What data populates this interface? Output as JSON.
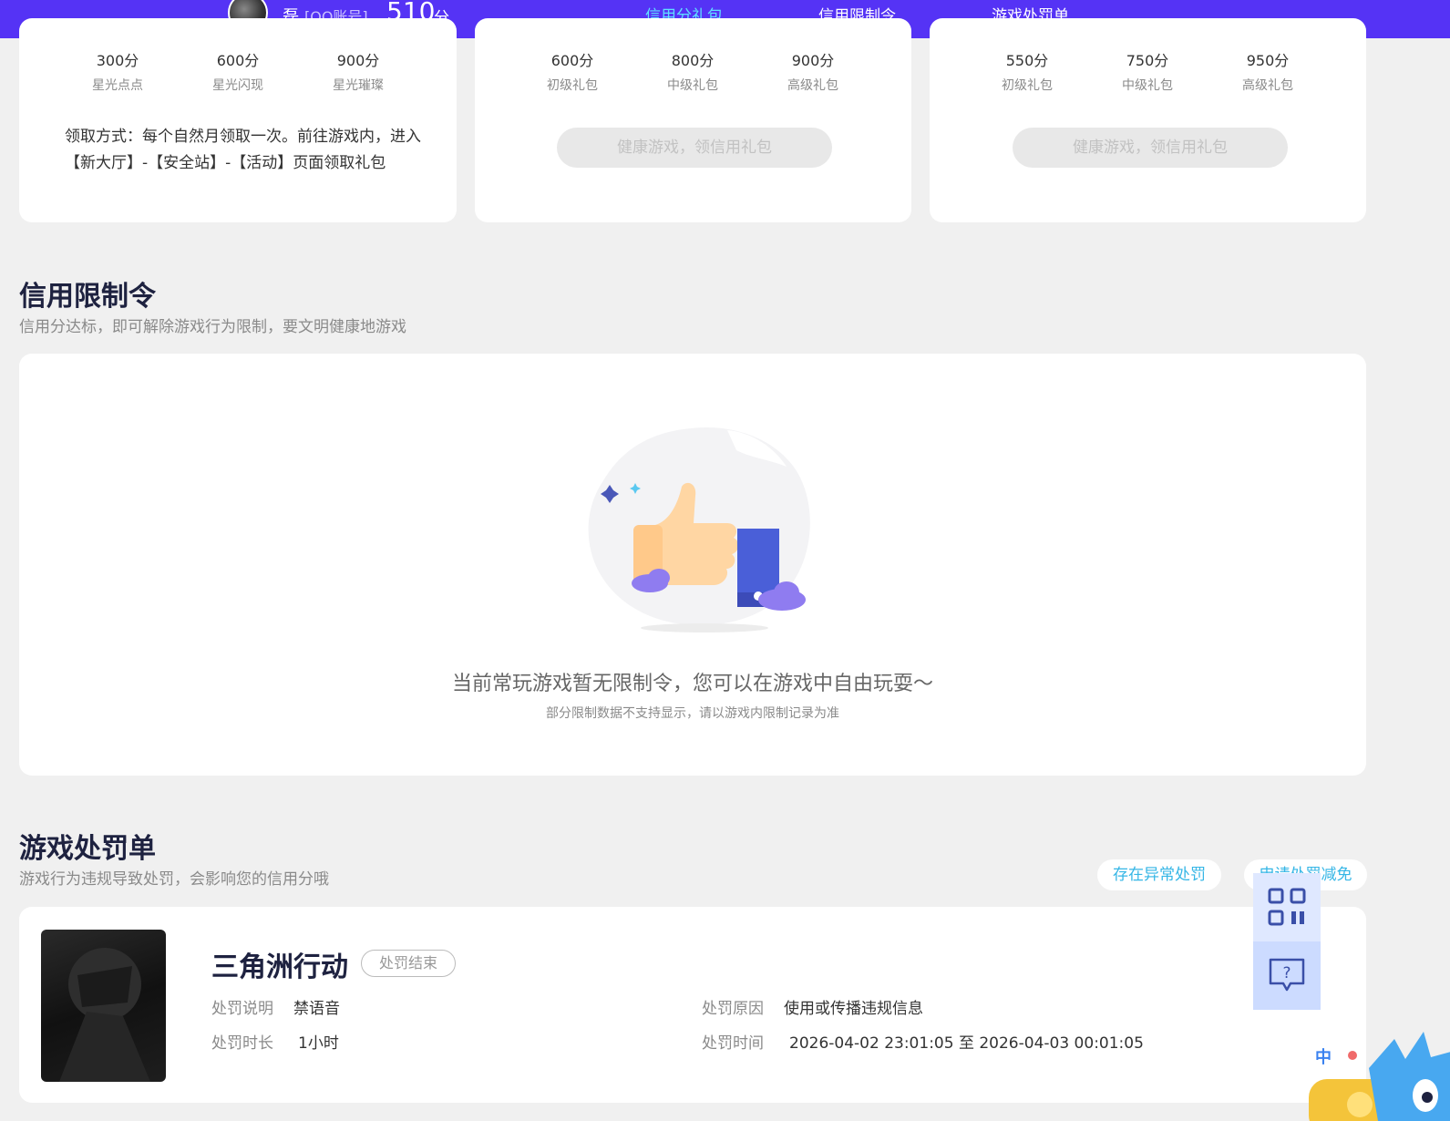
{
  "header": {
    "user_name": "磊",
    "account_type": "[QQ账号]",
    "score": "510",
    "score_unit": "分",
    "tabs": [
      {
        "label": "信用分礼包",
        "active": true
      },
      {
        "label": "信用限制令",
        "active": false
      },
      {
        "label": "游戏处罚单",
        "active": false
      }
    ]
  },
  "gift_cards": [
    {
      "tiers": [
        {
          "points": "300分",
          "name": "星光点点"
        },
        {
          "points": "600分",
          "name": "星光闪现"
        },
        {
          "points": "900分",
          "name": "星光璀璨"
        }
      ],
      "claim_note": "领取方式：每个自然月领取一次。前往游戏内，进入【新大厅】-【安全站】-【活动】页面领取礼包"
    },
    {
      "tiers": [
        {
          "points": "600分",
          "name": "初级礼包"
        },
        {
          "points": "800分",
          "name": "中级礼包"
        },
        {
          "points": "900分",
          "name": "高级礼包"
        }
      ],
      "button_label": "健康游戏，领信用礼包"
    },
    {
      "tiers": [
        {
          "points": "550分",
          "name": "初级礼包"
        },
        {
          "points": "750分",
          "name": "中级礼包"
        },
        {
          "points": "950分",
          "name": "高级礼包"
        }
      ],
      "button_label": "健康游戏，领信用礼包"
    }
  ],
  "restriction": {
    "title": "信用限制令",
    "subtitle": "信用分达标，即可解除游戏行为限制，要文明健康地游戏",
    "empty_message": "当前常玩游戏暂无限制令，您可以在游戏中自由玩耍～",
    "empty_note": "部分限制数据不支持显示，请以游戏内限制记录为准"
  },
  "penalty": {
    "title": "游戏处罚单",
    "subtitle": "游戏行为违规导致处罚，会影响您的信用分哦",
    "abnormal_button": "存在异常处罚",
    "appeal_button": "申请处罚减免",
    "record": {
      "game_name": "三角洲行动",
      "status": "处罚结束",
      "desc_label": "处罚说明",
      "desc_value": "禁语音",
      "duration_label": "处罚时长",
      "duration_value": "1小时",
      "reason_label": "处罚原因",
      "reason_value": "使用或传播违规信息",
      "time_label": "处罚时间",
      "time_value": "2026-04-02 23:01:05 至 2026-04-03 00:01:05"
    }
  },
  "float_panel": {
    "icons": [
      "qr-code-icon",
      "help-chat-icon"
    ]
  },
  "mascot_badge": "中",
  "colors": {
    "brand": "#5533f5",
    "active_tab": "#5fe0ff",
    "link": "#35b6e6"
  }
}
